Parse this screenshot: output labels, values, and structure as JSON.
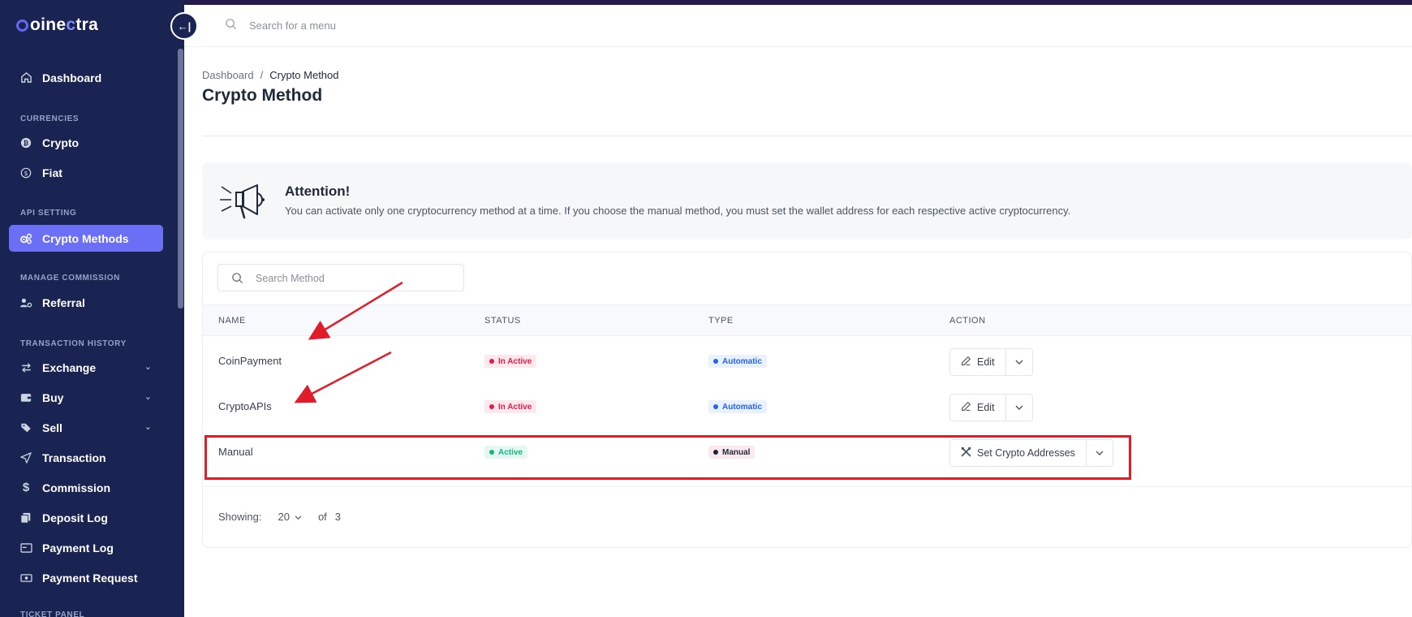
{
  "brand": {
    "logo_prefix": "",
    "logo_part1": "oine",
    "logo_accent": "c",
    "logo_part2": "tra"
  },
  "header": {
    "search_placeholder": "Search for a menu"
  },
  "sidebar": {
    "dashboard": "Dashboard",
    "sections": {
      "currencies": "CURRENCIES",
      "api_setting": "API SETTING",
      "manage_commission": "MANAGE COMMISSION",
      "transaction_history": "TRANSACTION HISTORY",
      "ticket_panel": "TICKET PANEL"
    },
    "items": {
      "crypto": "Crypto",
      "fiat": "Fiat",
      "crypto_methods": "Crypto Methods",
      "referral": "Referral",
      "exchange": "Exchange",
      "buy": "Buy",
      "sell": "Sell",
      "transaction": "Transaction",
      "commission": "Commission",
      "deposit_log": "Deposit Log",
      "payment_log": "Payment Log",
      "payment_request": "Payment Request"
    },
    "collapse_icon": "arrow-collapse-left-icon"
  },
  "breadcrumb": {
    "home": "Dashboard",
    "separator": "/",
    "current": "Crypto Method"
  },
  "page_title": "Crypto Method",
  "alert": {
    "title": "Attention!",
    "text": "You can activate only one cryptocurrency method at a time. If you choose the manual method, you must set the wallet address for each respective active cryptocurrency.",
    "icon": "megaphone-icon"
  },
  "table": {
    "search_placeholder": "Search Method",
    "headers": {
      "name": "NAME",
      "status": "STATUS",
      "type": "TYPE",
      "action": "ACTION"
    },
    "rows": [
      {
        "name": "CoinPayment",
        "status": "In Active",
        "type": "Automatic",
        "action": "Edit"
      },
      {
        "name": "CryptoAPIs",
        "status": "In Active",
        "type": "Automatic",
        "action": "Edit"
      },
      {
        "name": "Manual",
        "status": "Active",
        "type": "Manual",
        "action": "Set Crypto Addresses"
      }
    ],
    "footer": {
      "showing_label": "Showing:",
      "per_page": "20",
      "of_label": "of",
      "total": "3"
    }
  },
  "colors": {
    "sidebar_bg": "#1a2452",
    "active_nav": "#6b6ff5",
    "annotation_red": "#e11d2a",
    "inactive_badge": "#e11d48",
    "active_badge": "#10b981",
    "automatic_badge": "#2563eb"
  }
}
